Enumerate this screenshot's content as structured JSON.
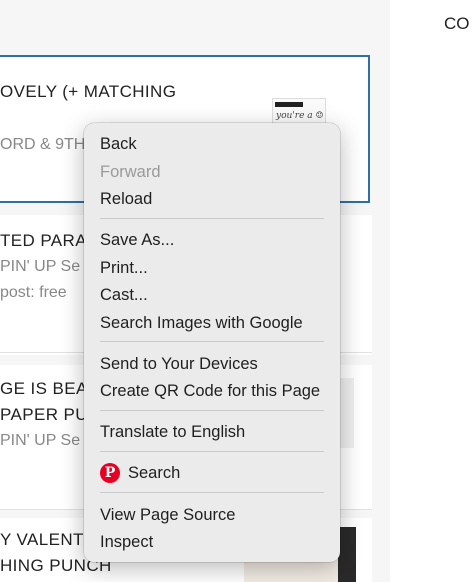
{
  "background": {
    "right_text": "CO",
    "cards": [
      {
        "title": "OVELY (+ MATCHING",
        "sub": "ORD & 9TH"
      },
      {
        "title": "TED PARAD",
        "sub1": "PIN' UP Se",
        "sub2": "post: free"
      },
      {
        "title1": "GE IS BEAU",
        "title2": "PAPER PUN",
        "sub": "PIN' UP Se"
      },
      {
        "title1": "Y VALENT",
        "title2": "HING PUNCH"
      }
    ]
  },
  "context_menu": {
    "items": [
      {
        "label": "Back",
        "enabled": true
      },
      {
        "label": "Forward",
        "enabled": false
      },
      {
        "label": "Reload",
        "enabled": true
      },
      {
        "label": "Save As...",
        "enabled": true
      },
      {
        "label": "Print...",
        "enabled": true
      },
      {
        "label": "Cast...",
        "enabled": true
      },
      {
        "label": "Search Images with Google",
        "enabled": true
      },
      {
        "label": "Send to Your Devices",
        "enabled": true
      },
      {
        "label": "Create QR Code for this Page",
        "enabled": true
      },
      {
        "label": "Translate to English",
        "enabled": true
      },
      {
        "label": "Search",
        "enabled": true,
        "icon": "pinterest-icon"
      },
      {
        "label": "View Page Source",
        "enabled": true
      },
      {
        "label": "Inspect",
        "enabled": true
      }
    ]
  },
  "colors": {
    "selection_border": "#2f6fa6",
    "pinterest_red": "#e60023",
    "menu_background": "#ebebeb"
  }
}
